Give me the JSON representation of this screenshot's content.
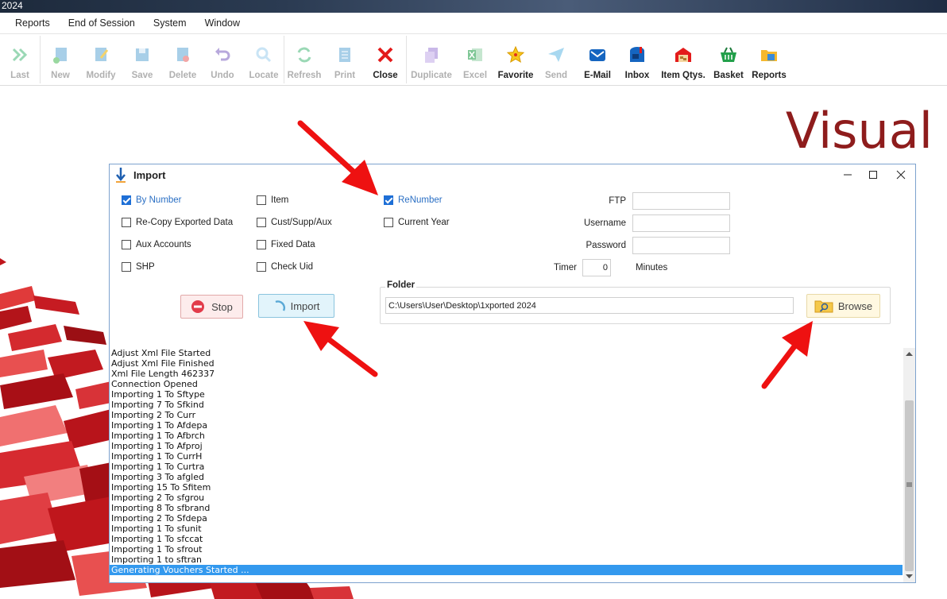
{
  "window": {
    "title": "2024"
  },
  "menubar": {
    "items": [
      "Reports",
      "End of Session",
      "System",
      "Window"
    ]
  },
  "toolbar": {
    "buttons": [
      {
        "label": "Last",
        "icon": "double-chevron-right-icon",
        "enabled": false
      },
      {
        "label": "New",
        "icon": "new-document-icon",
        "enabled": false
      },
      {
        "label": "Modify",
        "icon": "edit-document-icon",
        "enabled": false
      },
      {
        "label": "Save",
        "icon": "floppy-disk-icon",
        "enabled": false
      },
      {
        "label": "Delete",
        "icon": "delete-document-icon",
        "enabled": false
      },
      {
        "label": "Undo",
        "icon": "undo-arrow-icon",
        "enabled": false
      },
      {
        "label": "Locate",
        "icon": "magnifier-icon",
        "enabled": false
      },
      {
        "label": "Refresh",
        "icon": "refresh-icon",
        "enabled": false
      },
      {
        "label": "Print",
        "icon": "printer-icon",
        "enabled": false
      },
      {
        "label": "Close",
        "icon": "close-x-icon",
        "enabled": true
      },
      {
        "label": "Duplicate",
        "icon": "duplicate-icon",
        "enabled": false
      },
      {
        "label": "Excel",
        "icon": "excel-icon",
        "enabled": false
      },
      {
        "label": "Favorite",
        "icon": "star-icon",
        "enabled": true
      },
      {
        "label": "Send",
        "icon": "paper-plane-icon",
        "enabled": false
      },
      {
        "label": "E-Mail",
        "icon": "envelope-icon",
        "enabled": true
      },
      {
        "label": "Inbox",
        "icon": "mailbox-icon",
        "enabled": true
      },
      {
        "label": "Item Qtys.",
        "icon": "warehouse-icon",
        "enabled": true
      },
      {
        "label": "Basket",
        "icon": "basket-icon",
        "enabled": true
      },
      {
        "label": "Reports",
        "icon": "folder-reports-icon",
        "enabled": true
      }
    ]
  },
  "brand": {
    "text": "Visual"
  },
  "dialog": {
    "title": "Import",
    "checkboxes": {
      "by_number": {
        "label": "By Number",
        "checked": true
      },
      "recopy": {
        "label": "Re-Copy Exported Data",
        "checked": false
      },
      "aux_accounts": {
        "label": "Aux Accounts",
        "checked": false
      },
      "shp": {
        "label": "SHP",
        "checked": false
      },
      "item": {
        "label": "Item",
        "checked": false
      },
      "cust_supp_aux": {
        "label": "Cust/Supp/Aux",
        "checked": false
      },
      "fixed_data": {
        "label": "Fixed Data",
        "checked": false
      },
      "check_uid": {
        "label": "Check Uid",
        "checked": false
      },
      "renumber": {
        "label": "ReNumber",
        "checked": true
      },
      "current_year": {
        "label": "Current Year",
        "checked": false
      }
    },
    "ftp": {
      "label": "FTP",
      "value": ""
    },
    "username": {
      "label": "Username",
      "value": ""
    },
    "password": {
      "label": "Password",
      "value": ""
    },
    "timer": {
      "label": "Timer",
      "value": "0",
      "unit": "Minutes"
    },
    "folder": {
      "label": "Folder",
      "path": "C:\\Users\\User\\Desktop\\1xported 2024",
      "browse_label": "Browse"
    },
    "stop_label": "Stop",
    "import_label": "Import",
    "log": [
      "Adjust Xml File Started",
      "Adjust Xml File Finished",
      "Xml File Length 462337",
      "Connection Opened",
      "Importing 1 To Sftype",
      "Importing 7 To Sfkind",
      "Importing 2 To Curr",
      "Importing 1 To Afdepa",
      "Importing 1 To Afbrch",
      "Importing 1 To Afproj",
      "Importing 1 To CurrH",
      "Importing 1 To Curtra",
      "Importing 3 To afgled",
      "Importing 15 To Sfitem",
      "Importing 2 To sfgrou",
      "Importing 8 To sfbrand",
      "Importing 2 To Sfdepa",
      "Importing 1 To sfunit",
      "Importing 1 To sfccat",
      "Importing 1 To sfrout",
      "Importing 1 to sftran",
      "Generating Vouchers Started ..."
    ],
    "log_selected_index": 21
  },
  "colors": {
    "accent_blue": "#1e6fd6",
    "brand_red": "#8e1c1c",
    "annotation_red": "#ee1111",
    "log_selection": "#3399ee"
  }
}
